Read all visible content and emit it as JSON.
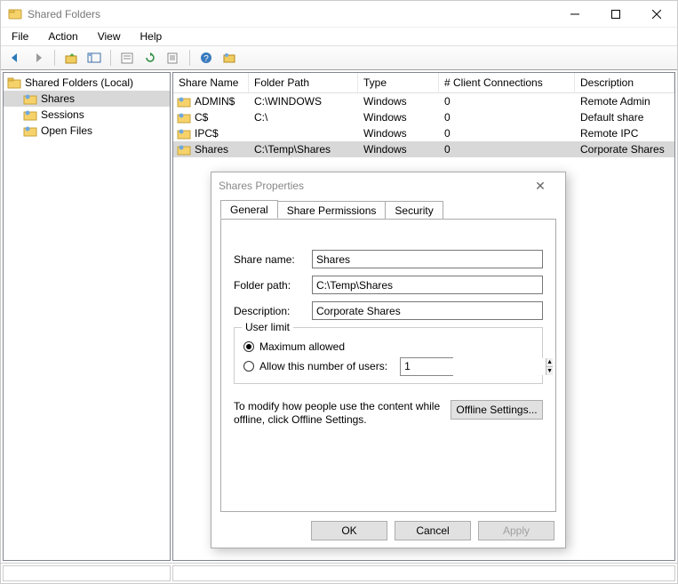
{
  "window": {
    "title": "Shared Folders"
  },
  "menu": {
    "file": "File",
    "action": "Action",
    "view": "View",
    "help": "Help"
  },
  "tree": {
    "root": "Shared Folders (Local)",
    "items": [
      {
        "label": "Shares",
        "selected": true
      },
      {
        "label": "Sessions"
      },
      {
        "label": "Open Files"
      }
    ]
  },
  "columns": {
    "name": "Share Name",
    "folder": "Folder Path",
    "type": "Type",
    "clients": "# Client Connections",
    "desc": "Description"
  },
  "rows": [
    {
      "name": "ADMIN$",
      "folder": "C:\\WINDOWS",
      "type": "Windows",
      "clients": "0",
      "desc": "Remote Admin"
    },
    {
      "name": "C$",
      "folder": "C:\\",
      "type": "Windows",
      "clients": "0",
      "desc": "Default share"
    },
    {
      "name": "IPC$",
      "folder": "",
      "type": "Windows",
      "clients": "0",
      "desc": "Remote IPC"
    },
    {
      "name": "Shares",
      "folder": "C:\\Temp\\Shares",
      "type": "Windows",
      "clients": "0",
      "desc": "Corporate Shares",
      "selected": true
    }
  ],
  "dialog": {
    "title": "Shares Properties",
    "tabs": {
      "general": "General",
      "perms": "Share Permissions",
      "security": "Security"
    },
    "labels": {
      "share_name": "Share name:",
      "folder_path": "Folder path:",
      "description": "Description:",
      "user_limit_legend": "User limit",
      "max_allowed": "Maximum allowed",
      "allow_number": "Allow this number of users:",
      "offline_text": "To modify how people use the content while offline, click Offline Settings.",
      "offline_btn": "Offline Settings...",
      "ok": "OK",
      "cancel": "Cancel",
      "apply": "Apply"
    },
    "values": {
      "share_name": "Shares",
      "folder_path": "C:\\Temp\\Shares",
      "description": "Corporate Shares",
      "user_limit_selected": "max",
      "user_number": "1"
    }
  }
}
